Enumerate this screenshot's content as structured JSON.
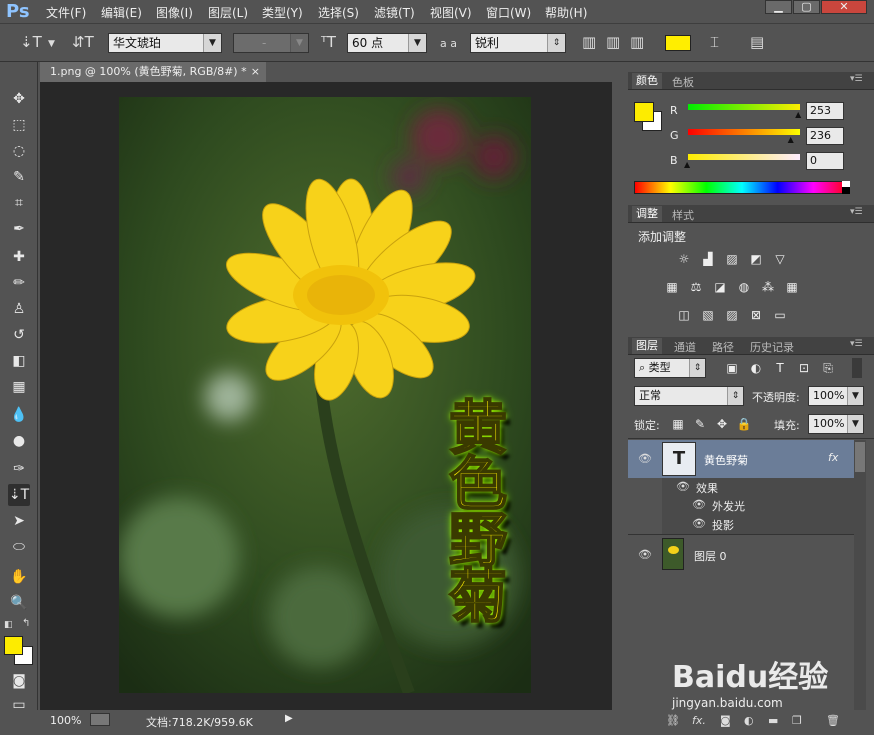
{
  "app": {
    "logo": "Ps"
  },
  "menu": [
    "文件(F)",
    "编辑(E)",
    "图像(I)",
    "图层(L)",
    "类型(Y)",
    "选择(S)",
    "滤镜(T)",
    "视图(V)",
    "窗口(W)",
    "帮助(H)"
  ],
  "window_controls": {
    "minimize": "▁",
    "restore": "▢",
    "close": "✕"
  },
  "options": {
    "font_family": "华文琥珀",
    "font_style": "-",
    "font_size": "60 点",
    "aa_label": "a a",
    "antialias": "锐利",
    "text_color": "#ffee00"
  },
  "document": {
    "tab_title": "1.png @ 100% (黄色野菊, RGB/8#) *",
    "tab_close": "×",
    "vertical_text": "黄色野菊",
    "zoom": "100%",
    "doc_info": "文档:718.2K/959.6K"
  },
  "colors": {
    "foreground": "#fdec00",
    "background": "#ffffff",
    "accent_yellow": "#ffee00"
  },
  "color_panel": {
    "tabs": [
      "颜色",
      "色板"
    ],
    "channels": [
      {
        "label": "R",
        "value": "253"
      },
      {
        "label": "G",
        "value": "236"
      },
      {
        "label": "B",
        "value": "0"
      }
    ]
  },
  "adjust_panel": {
    "tabs": [
      "调整",
      "样式"
    ],
    "title": "添加调整"
  },
  "layers_panel": {
    "tabs": [
      "图层",
      "通道",
      "路径",
      "历史记录"
    ],
    "filter_kind": "类型",
    "blend_mode": "正常",
    "opacity_label": "不透明度:",
    "opacity": "100%",
    "lock_label": "锁定:",
    "fill_label": "填充:",
    "fill": "100%",
    "layers": [
      {
        "name": "黄色野菊",
        "fx": "fx",
        "thumb_glyph": "T"
      },
      {
        "name": "图层 0"
      }
    ],
    "effects_label": "效果",
    "effects": [
      "外发光",
      "投影"
    ]
  },
  "watermark": {
    "brand": "Baidu经验",
    "url": "jingyan.baidu.com"
  }
}
